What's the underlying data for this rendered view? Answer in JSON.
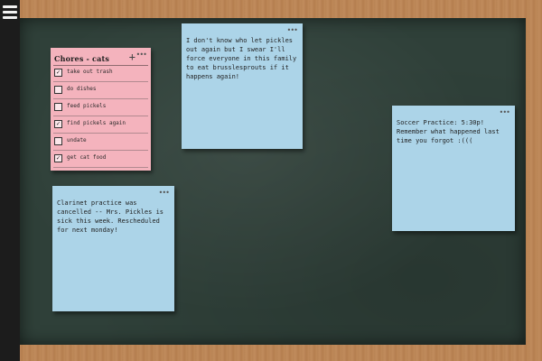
{
  "menu": {
    "icon": "hamburger-menu-icon"
  },
  "checklist": {
    "title": "Chores - cats",
    "add_label": "+",
    "more_label": "•••",
    "items": [
      {
        "label": "take out trash",
        "checked": true
      },
      {
        "label": "do dishes",
        "checked": false
      },
      {
        "label": "feed pickels",
        "checked": false
      },
      {
        "label": "find pickels again",
        "checked": true
      },
      {
        "label": "undate",
        "checked": false
      },
      {
        "label": "get cat food",
        "checked": true
      }
    ]
  },
  "notes": [
    {
      "id": "pickles",
      "more_label": "•••",
      "text": "I don't know who let pickles out again but I swear I'll force everyone in this family to eat brusslesprouts if it happens again!"
    },
    {
      "id": "soccer",
      "more_label": "•••",
      "text": "Soccer Practice: 5:30p!\nRemember what happened last time you forgot :((("
    },
    {
      "id": "clarinet",
      "more_label": "•••",
      "text": "Clarinet practice was cancelled -- Mrs. Pickles is sick this week. Rescheduled for next monday!"
    }
  ],
  "colors": {
    "pink_note": "#f4b3bd",
    "blue_note": "#acd4e8",
    "board": "#2f4039",
    "frame": "#b98455"
  }
}
